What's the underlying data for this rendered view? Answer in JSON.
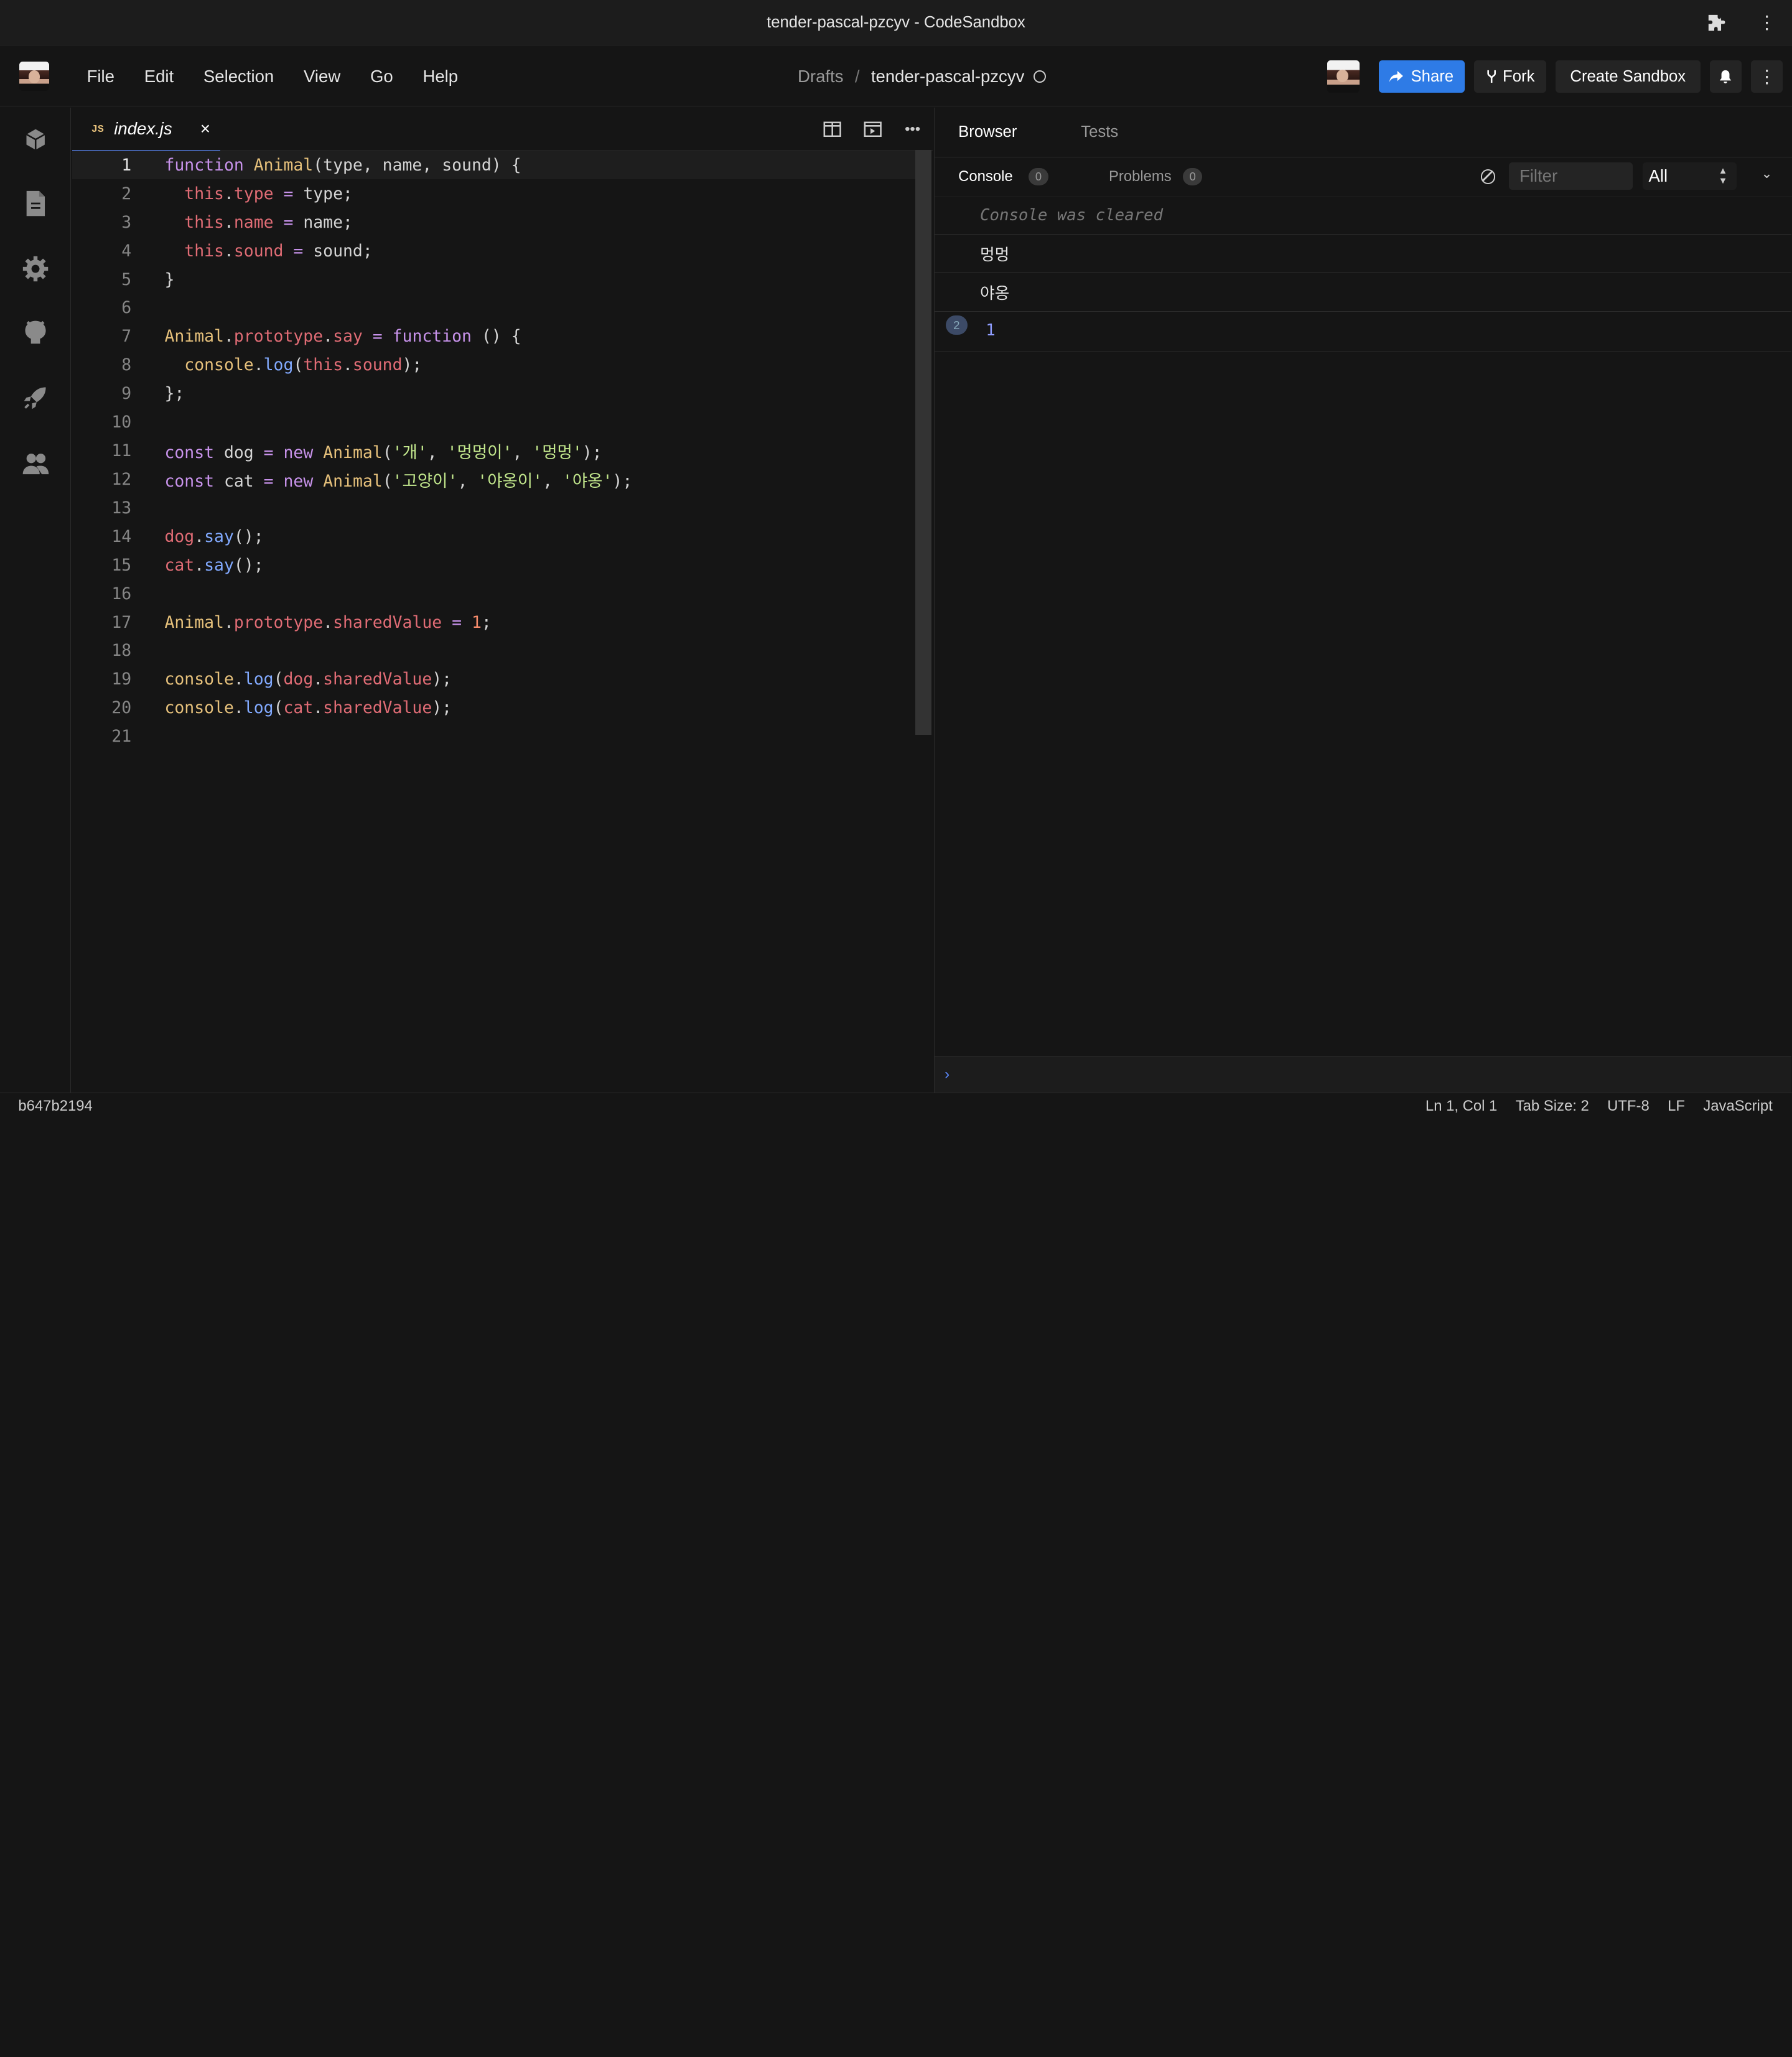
{
  "window": {
    "title": "tender-pascal-pzcyv - CodeSandbox"
  },
  "menu": {
    "file": "File",
    "edit": "Edit",
    "selection": "Selection",
    "view": "View",
    "go": "Go",
    "help": "Help"
  },
  "breadcrumb": {
    "folder": "Drafts",
    "separator": "/",
    "name": "tender-pascal-pzcyv"
  },
  "header_actions": {
    "share": "Share",
    "fork": "Fork",
    "create": "Create Sandbox"
  },
  "editor": {
    "tab": {
      "badge": "JS",
      "filename": "index.js",
      "close": "×"
    },
    "lines": [
      "function Animal(type, name, sound) {",
      "  this.type = type;",
      "  this.name = name;",
      "  this.sound = sound;",
      "}",
      "",
      "Animal.prototype.say = function () {",
      "  console.log(this.sound);",
      "};",
      "",
      "const dog = new Animal('개', '멍멍이', '멍멍');",
      "const cat = new Animal('고양이', '야옹이', '야옹');",
      "",
      "dog.say();",
      "cat.say();",
      "",
      "Animal.prototype.sharedValue = 1;",
      "",
      "console.log(dog.sharedValue);",
      "console.log(cat.sharedValue);",
      ""
    ]
  },
  "preview": {
    "tabs": {
      "browser": "Browser",
      "tests": "Tests"
    },
    "console_tab": "Console",
    "console_count": "0",
    "problems_tab": "Problems",
    "problems_count": "0",
    "filter_placeholder": "Filter",
    "level_select": "All",
    "entries": {
      "cleared": "Console was cleared",
      "log1": "멍멍",
      "log2": "야옹",
      "repeat_count": "2",
      "log3": "1"
    },
    "prompt": "›"
  },
  "status": {
    "hash": "b647b2194",
    "position": "Ln 1, Col 1",
    "tab_size": "Tab Size: 2",
    "encoding": "UTF-8",
    "eol": "LF",
    "language": "JavaScript"
  },
  "colors": {
    "accent": "#2e7be6",
    "tab_indicator": "#5c8aff",
    "bg": "#151515"
  }
}
